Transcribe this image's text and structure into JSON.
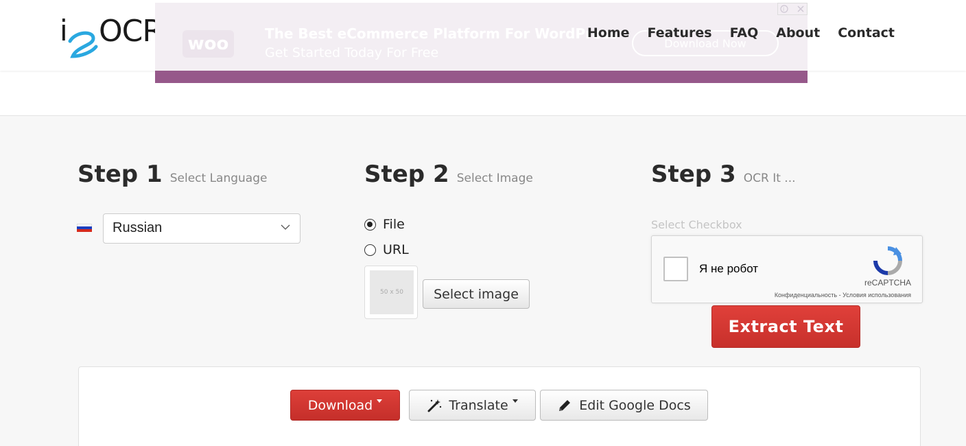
{
  "logo": {
    "text": "OCR",
    "prefix": "i",
    "icon": "i2ocr-logo-icon"
  },
  "ad": {
    "brand": "woo",
    "title": "The Best eCommerce Platform For WordPress",
    "subtitle": "Get Started Today For Free",
    "cta": "Download Now",
    "choices_icon": "adchoices-icon",
    "accent_color": "#96588a"
  },
  "nav": {
    "items": [
      {
        "label": "Home"
      },
      {
        "label": "Features"
      },
      {
        "label": "FAQ"
      },
      {
        "label": "About"
      },
      {
        "label": "Contact"
      }
    ]
  },
  "step1": {
    "title": "Step 1",
    "subtitle": "Select Language",
    "flag_icon": "russia-flag-icon",
    "language_selected": "Russian"
  },
  "step2": {
    "title": "Step 2",
    "subtitle": "Select Image",
    "options": [
      {
        "label": "File",
        "checked": true
      },
      {
        "label": "URL",
        "checked": false
      }
    ],
    "thumbnail_placeholder": "50 x 50",
    "select_button": "Select image"
  },
  "step3": {
    "title": "Step 3",
    "subtitle": "OCR It ...",
    "checkbox_label": "Select Checkbox",
    "captcha": {
      "label": "Я не робот",
      "brand": "reCAPTCHA",
      "links": "Конфиденциальность - Условия использования"
    },
    "extract_button": "Extract Text"
  },
  "results": {
    "download_button": "Download",
    "translate_button": "Translate",
    "gdocs_button": "Edit Google Docs"
  },
  "colors": {
    "primary_red": "#d0352f",
    "text_dark": "#2b2b2b"
  }
}
